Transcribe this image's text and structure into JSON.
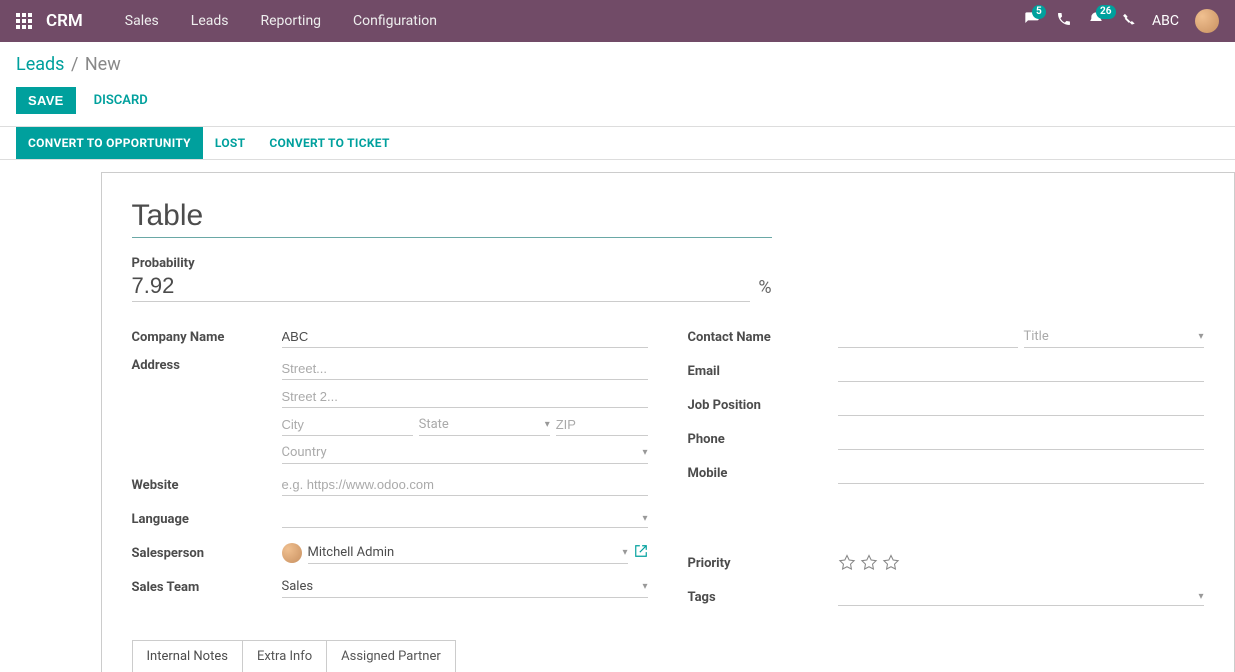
{
  "nav": {
    "brand": "CRM",
    "links": [
      "Sales",
      "Leads",
      "Reporting",
      "Configuration"
    ],
    "messages_badge": "5",
    "activities_badge": "26",
    "company": "ABC"
  },
  "breadcrumb": {
    "root": "Leads",
    "current": "New"
  },
  "actions": {
    "save": "SAVE",
    "discard": "DISCARD"
  },
  "statusbar": {
    "convert_opp": "CONVERT TO OPPORTUNITY",
    "lost": "LOST",
    "convert_ticket": "CONVERT TO TICKET"
  },
  "form": {
    "title": "Table",
    "probability_label": "Probability",
    "probability_value": "7.92",
    "pct": "%",
    "labels": {
      "company_name": "Company Name",
      "address": "Address",
      "website": "Website",
      "language": "Language",
      "salesperson": "Salesperson",
      "sales_team": "Sales Team",
      "contact_name": "Contact Name",
      "email": "Email",
      "job_position": "Job Position",
      "phone": "Phone",
      "mobile": "Mobile",
      "priority": "Priority",
      "tags": "Tags"
    },
    "values": {
      "company_name": "ABC",
      "salesperson": "Mitchell Admin",
      "sales_team": "Sales"
    },
    "placeholders": {
      "street": "Street...",
      "street2": "Street 2...",
      "city": "City",
      "state": "State",
      "zip": "ZIP",
      "country": "Country",
      "website": "e.g. https://www.odoo.com",
      "title": "Title"
    }
  },
  "tabs": [
    "Internal Notes",
    "Extra Info",
    "Assigned Partner"
  ]
}
